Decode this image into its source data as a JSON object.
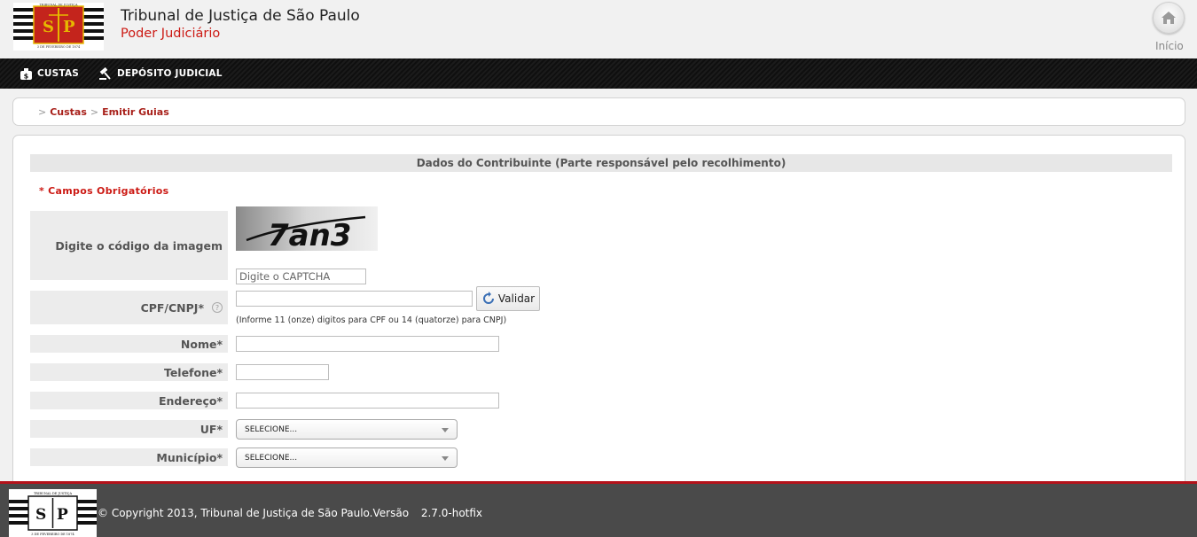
{
  "header": {
    "logo_top_text": "TRIBUNAL DE JUSTIÇA",
    "logo_bottom_text": "3 DE FEVEREIRO DE 1874",
    "logo_letters": [
      "S",
      "P"
    ],
    "title": "Tribunal de Justiça de São Paulo",
    "subtitle": "Poder Judiciário",
    "home_label": "Início"
  },
  "nav": {
    "items": [
      {
        "label": "CUSTAS",
        "icon": "money-bag-icon"
      },
      {
        "label": "DEPÓSITO JUDICIAL",
        "icon": "gavel-icon"
      }
    ]
  },
  "breadcrumb": {
    "separator": ">",
    "items": [
      "Custas",
      "Emitir Guias"
    ]
  },
  "form": {
    "section_title": "Dados do Contribuinte (Parte responsável pelo recolhimento)",
    "required_note": "* Campos Obrigatórios",
    "captcha": {
      "label": "Digite o código da imagem",
      "image_text": "7an3",
      "placeholder": "Digite o CAPTCHA",
      "value": ""
    },
    "cpf": {
      "label": "CPF/CNPJ*",
      "help_icon": "?",
      "value": "",
      "validate_label": "Validar",
      "hint": "(Informe 11 (onze) digitos para CPF ou 14 (quatorze) para CNPJ)"
    },
    "nome": {
      "label": "Nome*",
      "value": ""
    },
    "telefone": {
      "label": "Telefone*",
      "value": ""
    },
    "endereco": {
      "label": "Endereço*",
      "value": ""
    },
    "uf": {
      "label": "UF*",
      "selected": "SELECIONE..."
    },
    "municipio": {
      "label": "Município*",
      "selected": "SELECIONE..."
    }
  },
  "footer": {
    "logo_top_text": "TRIBUNAL DE JUSTIÇA",
    "logo_bottom_text": "3 DE FEVEREIRO DE 1874",
    "logo_letters": [
      "S",
      "P"
    ],
    "copyright": "© Copyright 2013, Tribunal de Justiça de São Paulo.Versão",
    "version": "2.7.0-hotfix"
  },
  "colors": {
    "brand_red": "#cc1a14",
    "crumb_red": "#a8201a",
    "footer_bg": "#4a4a4a",
    "footer_border": "#b4121a"
  }
}
